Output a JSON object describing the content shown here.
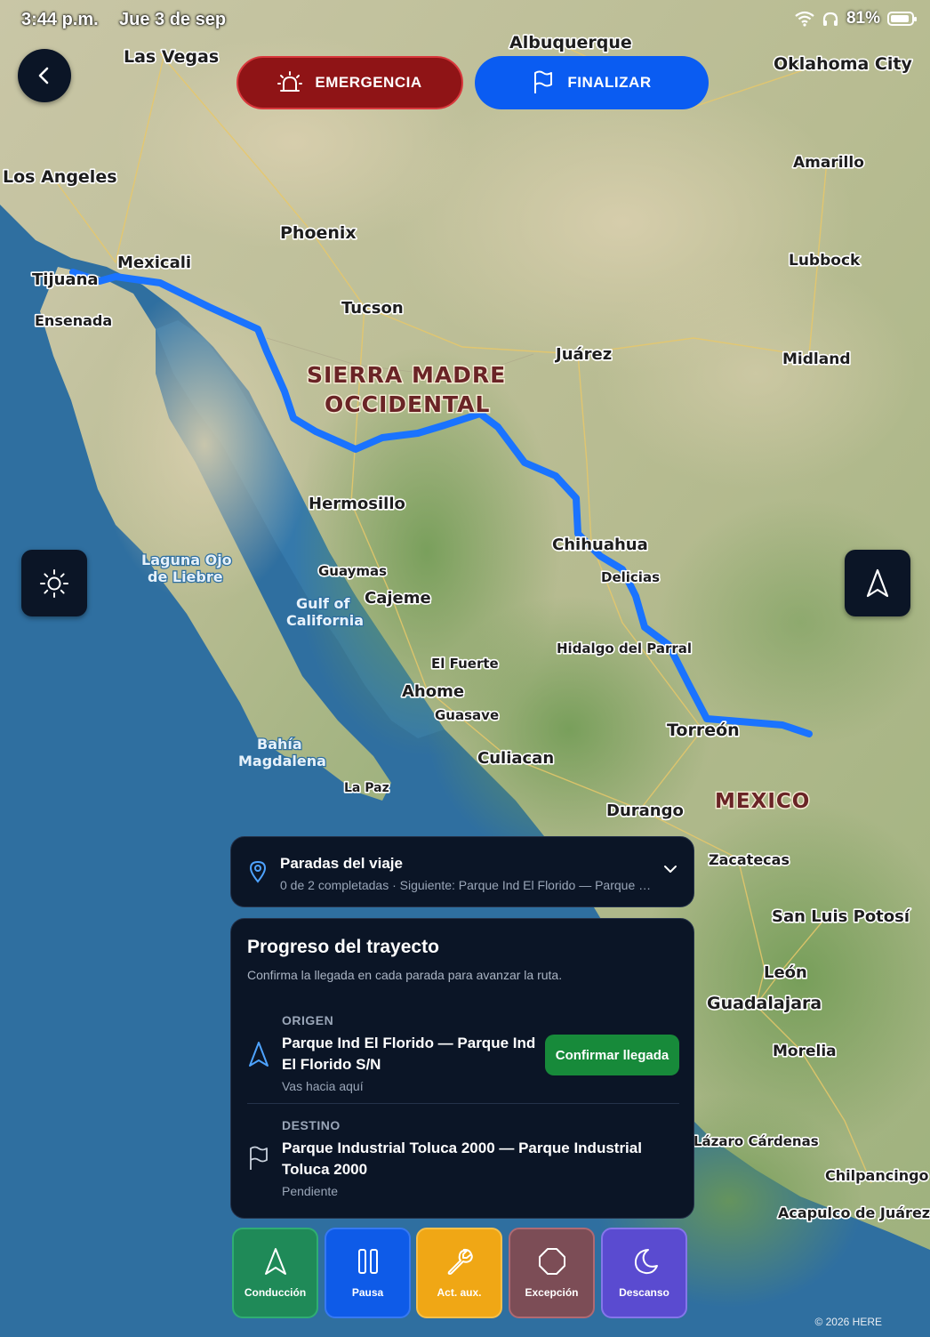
{
  "status_bar": {
    "time": "3:44 p.m.",
    "date": "Jue 3 de sep",
    "battery": "81%"
  },
  "header": {
    "emergency_label": "EMERGENCIA",
    "finish_label": "FINALIZAR"
  },
  "map": {
    "labels": {
      "las_vegas": "Las Vegas",
      "albuquerque": "Albuquerque",
      "oklahoma": "Oklahoma City",
      "los_angeles": "Los Angeles",
      "amarillo": "Amarillo",
      "phoenix": "Phoenix",
      "mexicali": "Mexicali",
      "tijuana": "Tijuana",
      "lubbock": "Lubbock",
      "ensenada": "Ensenada",
      "tucson": "Tucson",
      "juarez": "Juárez",
      "midland": "Midland",
      "sierra1": "SIERRA MADRE",
      "sierra2": "OCCIDENTAL",
      "hermosillo": "Hermosillo",
      "chihuahua": "Chihuahua",
      "laguna1": "Laguna Ojo",
      "laguna2": "de Liebre",
      "guaymas": "Guaymas",
      "delicias": "Delicias",
      "gulf1": "Gulf of",
      "gulf2": "California",
      "cajeme": "Cajeme",
      "parral": "Hidalgo del Parral",
      "elfuerte": "El Fuerte",
      "ahome": "Ahome",
      "guasave": "Guasave",
      "torreon": "Torreón",
      "bahia1": "Bahía",
      "bahia2": "Magdalena",
      "culiacan": "Culiacan",
      "lapaz": "La Paz",
      "durango": "Durango",
      "mexico": "MEXICO",
      "zacatecas": "Zacatecas",
      "slp": "San Luis Potosí",
      "leon": "León",
      "guadalajara": "Guadalajara",
      "morelia": "Morelia",
      "lazaro": "Lázaro Cárdenas",
      "chilpancingo": "Chilpancingo",
      "acapulco": "Acapulco de Juárez"
    },
    "route_color": "#1a73ff",
    "copyright": "© 2026 HERE"
  },
  "stops_panel": {
    "title": "Paradas del viaje",
    "subtitle": "0 de 2 completadas · Siguiente: Parque Ind El Florido — Parque Ind El Florido S/N"
  },
  "progress_panel": {
    "title": "Progreso del trayecto",
    "subtitle": "Confirma la llegada en cada parada para avanzar la ruta.",
    "origin": {
      "kind": "ORIGEN",
      "name": "Parque Ind El Florido — Parque Ind El Florido S/N",
      "state": "Vas hacia aquí",
      "action": "Confirmar llegada"
    },
    "destination": {
      "kind": "DESTINO",
      "name": "Parque Industrial Toluca 2000 — Parque Industrial Toluca 2000",
      "state": "Pendiente"
    }
  },
  "actions": [
    {
      "label": "Conducción",
      "icon": "navigation-arrow-icon",
      "color": "#1f8a58"
    },
    {
      "label": "Pausa",
      "icon": "pause-icon",
      "color": "#0e5be8"
    },
    {
      "label": "Act. aux.",
      "icon": "wrench-icon",
      "color": "#f0a715"
    },
    {
      "label": "Excepción",
      "icon": "octagon-icon",
      "color": "#7c4d56"
    },
    {
      "label": "Descanso",
      "icon": "moon-icon",
      "color": "#5a4bd0"
    }
  ]
}
